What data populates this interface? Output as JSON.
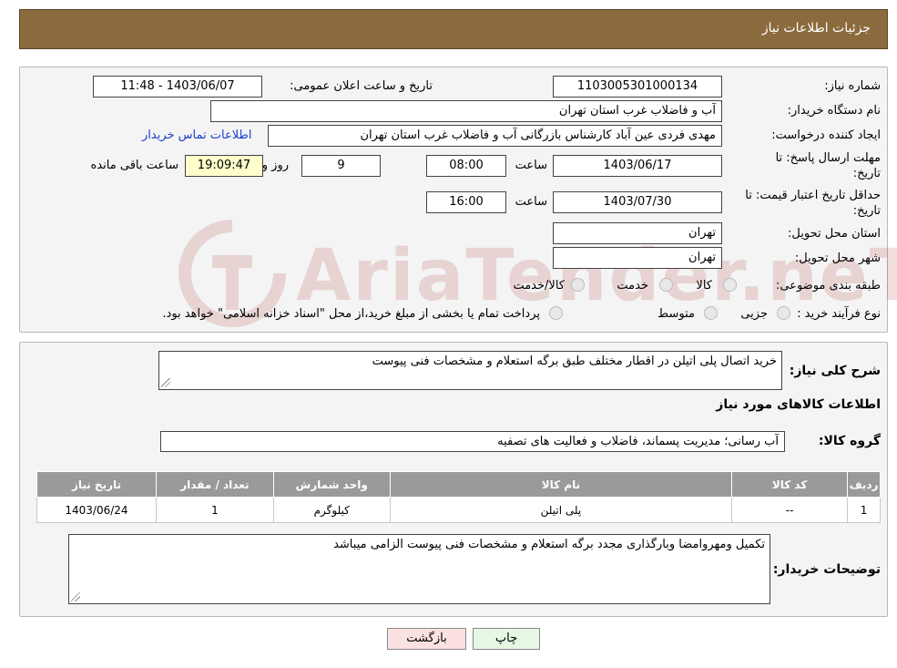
{
  "header": {
    "title": "جزئیات اطلاعات نیاز"
  },
  "form": {
    "need_number_label": "شماره نیاز:",
    "need_number": "1103005301000134",
    "announce_label": "تاریخ و ساعت اعلان عمومی:",
    "announce_value": "1403/06/07 - 11:48",
    "buyer_org_label": "نام دستگاه خریدار:",
    "buyer_org": "آب و فاضلاب غرب استان تهران",
    "creator_label": "ایجاد کننده درخواست:",
    "creator": "مهدی فردی عین آباد کارشناس بازرگانی آب و فاضلاب غرب استان تهران",
    "contact_link": "اطلاعات تماس خریدار",
    "deadline_label_1": "مهلت ارسال پاسخ: تا",
    "deadline_label_2": "تاریخ:",
    "deadline_date": "1403/06/17",
    "time_label": "ساعت",
    "deadline_time": "08:00",
    "days_value": "9",
    "days_label": "روز و",
    "remaining_time": "19:09:47",
    "remaining_label": "ساعت باقی مانده",
    "validity_label_1": "حداقل تاریخ اعتبار قیمت: تا",
    "validity_label_2": "تاریخ:",
    "validity_date": "1403/07/30",
    "validity_time": "16:00",
    "province_label": "استان محل تحویل:",
    "province": "تهران",
    "city_label": "شهر محل تحویل:",
    "city": "تهران",
    "category_label": "طبقه بندی موضوعی:",
    "category_options": [
      "کالا",
      "خدمت",
      "کالا/خدمت"
    ],
    "process_label": "نوع فرآیند خرید :",
    "process_options": [
      "جزیی",
      "متوسط"
    ],
    "process_note": "پرداخت تمام یا بخشی از مبلغ خرید،از محل \"اسناد خزانه اسلامی\" خواهد بود."
  },
  "details": {
    "description_label": "شرح کلی نیاز:",
    "description": "خرید اتصال پلی اتیلن در اقطار مختلف طبق برگه استعلام و مشخصات فنی پیوست",
    "goods_info_title": "اطلاعات کالاهای مورد نیاز",
    "group_label": "گروه کالا:",
    "group_value": "آب رسانی؛ مدیریت پسماند، فاضلاب و فعالیت های تصفیه",
    "table": {
      "headers": [
        "ردیف",
        "کد کالا",
        "نام کالا",
        "واحد شمارش",
        "تعداد / مقدار",
        "تاریخ نیاز"
      ],
      "rows": [
        [
          "1",
          "--",
          "پلی اتیلن",
          "کیلوگرم",
          "1",
          "1403/06/24"
        ]
      ]
    },
    "buyer_notes_label": "توضیحات خریدار:",
    "buyer_notes": "تکمیل ومهروامضا وبارگذاری مجدد برگه استعلام و مشخصات فنی پیوست الزامی میباشد"
  },
  "buttons": {
    "print": "چاپ",
    "back": "بازگشت"
  },
  "watermark": {
    "text": "AriaTender.neT"
  },
  "colors": {
    "header": "#8b6a3e",
    "table_header": "#9a9a9a",
    "remaining_bg": "#ffffcc",
    "link": "#1a3fd0"
  }
}
